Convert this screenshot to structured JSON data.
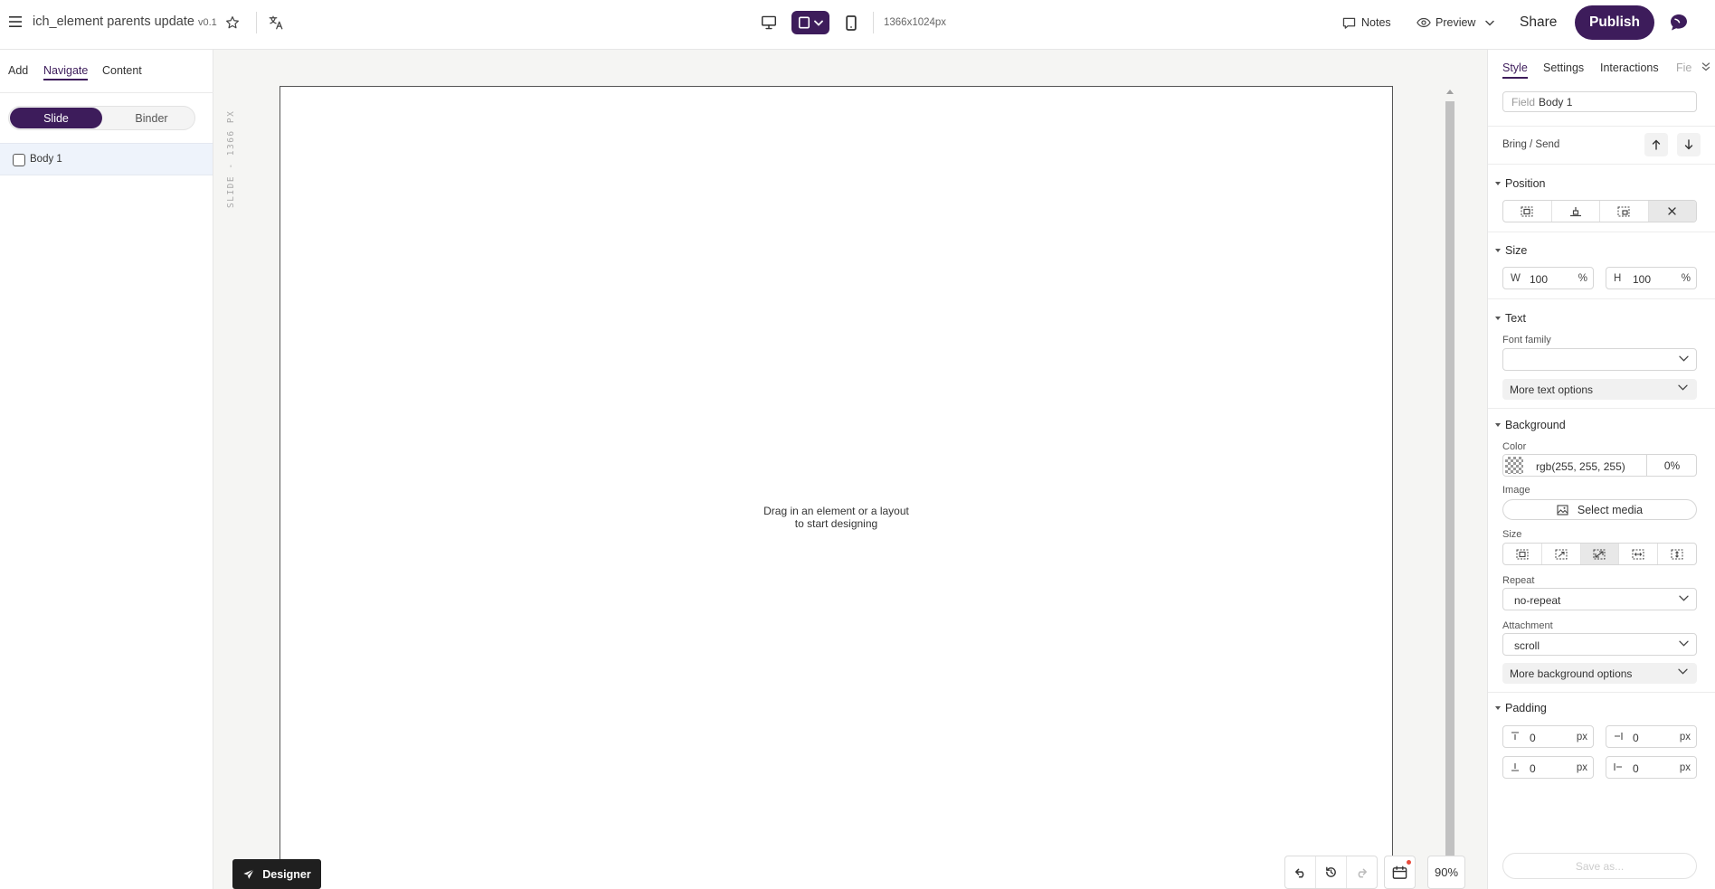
{
  "topbar": {
    "doc_title": "ich_element parents update",
    "doc_version": "v0.1",
    "resolution": "1366x1024px",
    "notes_label": "Notes",
    "preview_label": "Preview",
    "share_label": "Share",
    "publish_label": "Publish"
  },
  "left_panel": {
    "tabs": [
      {
        "label": "Add"
      },
      {
        "label": "Navigate"
      },
      {
        "label": "Content"
      }
    ],
    "active_tab": "Navigate",
    "segment": {
      "slide": "Slide",
      "binder": "Binder",
      "selected": "Slide"
    },
    "tree": [
      {
        "label": "Body 1",
        "checked": false
      }
    ]
  },
  "canvas": {
    "ruler_label": "SLIDE - 1366 PX",
    "empty_line1": "Drag in an element or a layout",
    "empty_line2": "to start designing",
    "designer_label": "Designer",
    "zoom": "90%"
  },
  "right_panel": {
    "tabs": [
      {
        "label": "Style"
      },
      {
        "label": "Settings"
      },
      {
        "label": "Interactions"
      },
      {
        "label": "Fie"
      }
    ],
    "active_tab": "Style",
    "element_prefix": "Field",
    "element_name": "Body 1",
    "bring_send_label": "Bring / Send",
    "position_title": "Position",
    "size_title": "Size",
    "width_prefix": "W",
    "width_value": "100",
    "width_unit": "%",
    "height_prefix": "H",
    "height_value": "100",
    "height_unit": "%",
    "text_title": "Text",
    "font_family_label": "Font family",
    "font_family_value": "",
    "more_text_label": "More text options",
    "background_title": "Background",
    "color_label": "Color",
    "color_value": "rgb(255, 255, 255)",
    "color_opacity": "0%",
    "image_label": "Image",
    "select_media_label": "Select media",
    "bg_size_label": "Size",
    "repeat_label": "Repeat",
    "repeat_value": "no-repeat",
    "attachment_label": "Attachment",
    "attachment_value": "scroll",
    "more_bg_label": "More background options",
    "padding_title": "Padding",
    "padding": {
      "top": "0",
      "right": "0",
      "bottom": "0",
      "left": "0",
      "unit": "px"
    },
    "save_as_label": "Save as..."
  },
  "colors": {
    "brand_purple": "#3d1c5b",
    "canvas_bg": "#f5f5f3",
    "selection_bg": "#eef3fb"
  }
}
